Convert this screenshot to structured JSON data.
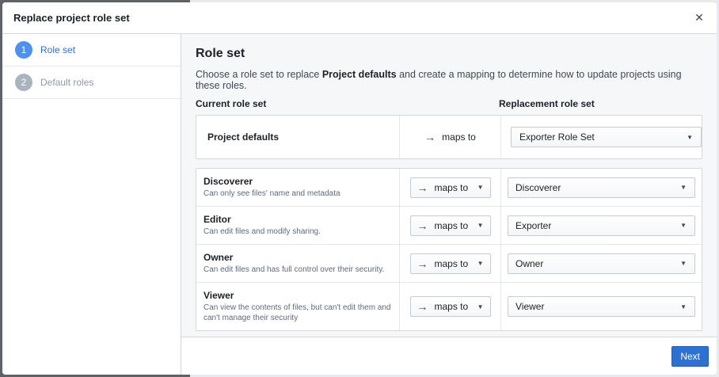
{
  "dialog": {
    "title": "Replace project role set",
    "close_icon": "close-icon"
  },
  "steps": [
    {
      "number": "1",
      "label": "Role set",
      "state": "active"
    },
    {
      "number": "2",
      "label": "Default roles",
      "state": "inactive"
    }
  ],
  "main": {
    "title": "Role set",
    "description_prefix": "Choose a role set to replace ",
    "description_bold": "Project defaults",
    "description_suffix": " and create a mapping to determine how to update projects using these roles.",
    "current_header": "Current role set",
    "replacement_header": "Replacement role set"
  },
  "defaults": {
    "name": "Project defaults",
    "maps_label": "maps to",
    "replacement": "Exporter Role Set"
  },
  "roles": [
    {
      "name": "Discoverer",
      "description": "Can only see files' name and metadata",
      "maps_label": "maps to",
      "replacement": "Discoverer"
    },
    {
      "name": "Editor",
      "description": "Can edit files and modify sharing.",
      "maps_label": "maps to",
      "replacement": "Exporter"
    },
    {
      "name": "Owner",
      "description": "Can edit files and has full control over their security.",
      "maps_label": "maps to",
      "replacement": "Owner"
    },
    {
      "name": "Viewer",
      "description": "Can view the contents of files, but can't edit them and can't manage their security",
      "maps_label": "maps to",
      "replacement": "Viewer"
    }
  ],
  "footer": {
    "next_label": "Next"
  },
  "colors": {
    "accent": "#2d72d2",
    "step_active": "#4c90f0",
    "step_inactive": "#abb3bf"
  }
}
